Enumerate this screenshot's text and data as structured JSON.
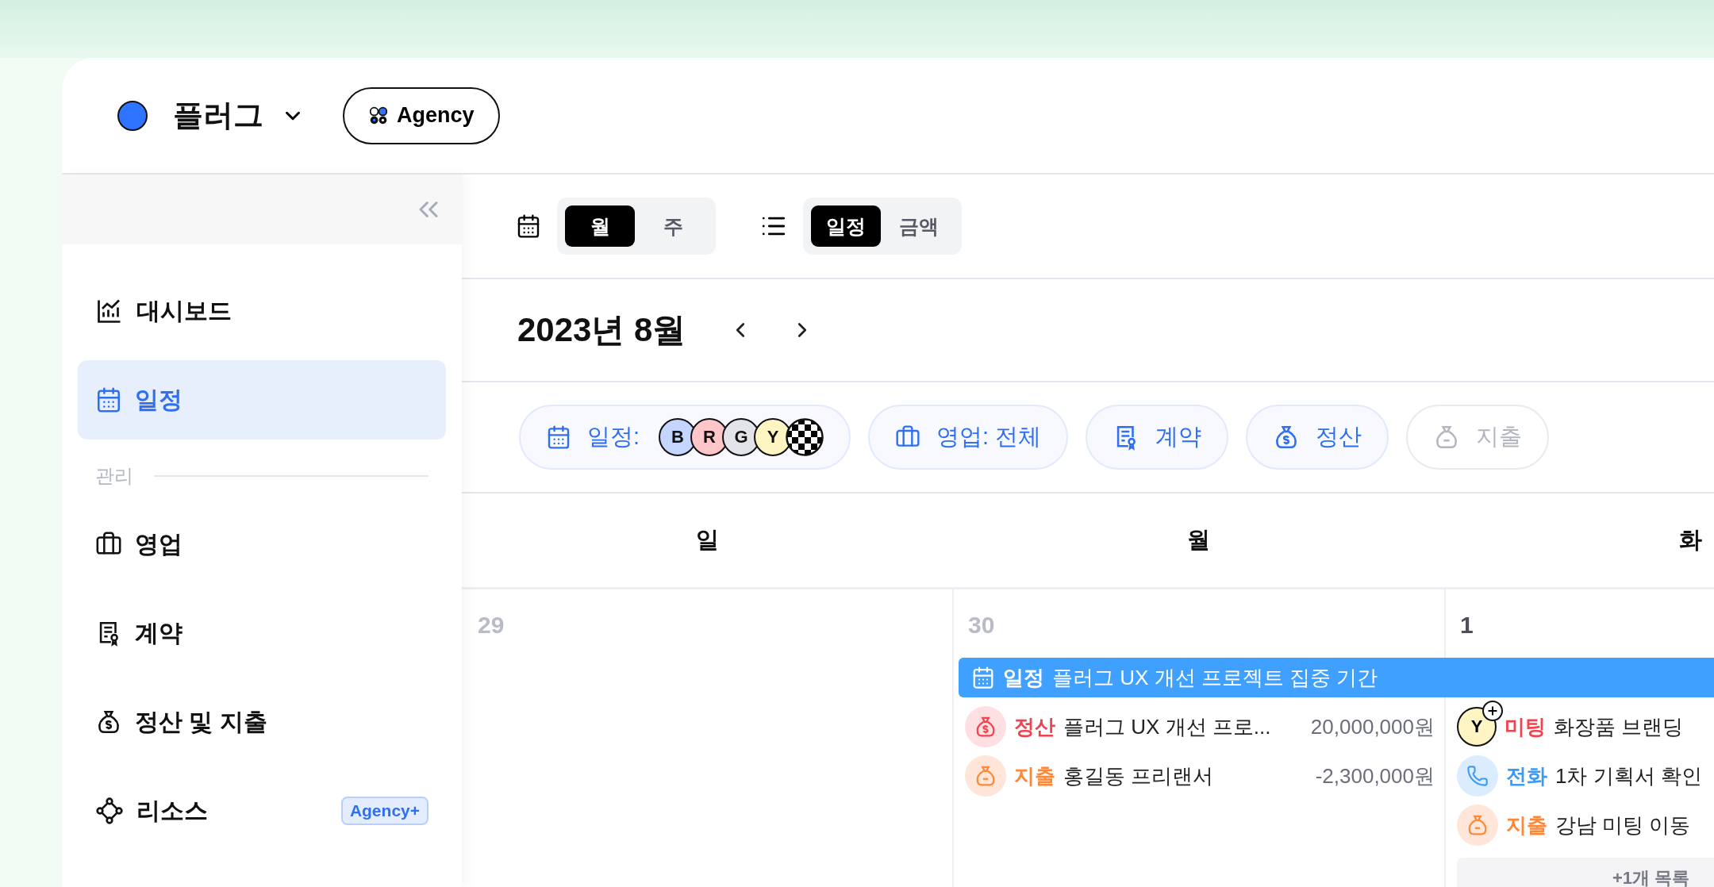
{
  "header": {
    "workspace": {
      "name": "플러그",
      "color": "#2f74ff"
    },
    "plan_badge": "Agency"
  },
  "sidebar": {
    "items": [
      {
        "label": "대시보드",
        "selected": false
      },
      {
        "label": "일정",
        "selected": true
      }
    ],
    "section": {
      "title": "관리",
      "items": [
        {
          "label": "영업",
          "selected": false
        },
        {
          "label": "계약",
          "selected": false
        },
        {
          "label": "정산 및 지출",
          "selected": false
        },
        {
          "label": "리소스",
          "selected": false,
          "badge": "Agency+"
        }
      ]
    }
  },
  "toolbar": {
    "view_toggle": [
      {
        "label": "월",
        "selected": true
      },
      {
        "label": "주",
        "selected": false
      }
    ],
    "mode_toggle": [
      {
        "label": "일정",
        "selected": true
      },
      {
        "label": "금액",
        "selected": false
      }
    ]
  },
  "month_title": "2023년 8월",
  "filters": [
    {
      "label": "일정:",
      "on": true,
      "avatars": [
        {
          "letter": "B",
          "color": "#c4d6ff"
        },
        {
          "letter": "R",
          "color": "#ffc6ca"
        },
        {
          "letter": "G",
          "color": "#e3e4e9"
        },
        {
          "letter": "Y",
          "color": "#fff5c2"
        },
        {
          "kind": "checker"
        }
      ]
    },
    {
      "label": "영업: 전체",
      "on": true
    },
    {
      "label": "계약",
      "on": true
    },
    {
      "label": "정산",
      "on": true
    },
    {
      "label": "지출",
      "on": false
    }
  ],
  "weekdays": [
    "일",
    "월",
    "화"
  ],
  "banner": {
    "tag": "일정",
    "title": "플러그 UX 개선 프로젝트 집중 기간"
  },
  "days": [
    {
      "date": "29",
      "muted": true
    },
    {
      "date": "30",
      "muted": true,
      "events": [
        {
          "kind": "settlement",
          "tag": "정산",
          "title": "플러그 UX 개선 프로...",
          "amount": "20,000,000원"
        },
        {
          "kind": "expense",
          "tag": "지출",
          "title": "홍길동 프리랜서",
          "amount": "-2,300,000원"
        }
      ]
    },
    {
      "date": "1",
      "muted": false,
      "events": [
        {
          "kind": "meeting",
          "tag": "미팅",
          "title": "화장품 브랜딩",
          "avatar": "Y",
          "color": "#fff5c2"
        },
        {
          "kind": "call",
          "tag": "전화",
          "title": "1차 기획서 확인"
        },
        {
          "kind": "expense",
          "tag": "지출",
          "title": "강남 미팅 이동"
        }
      ],
      "more": "+1개 목록"
    }
  ]
}
